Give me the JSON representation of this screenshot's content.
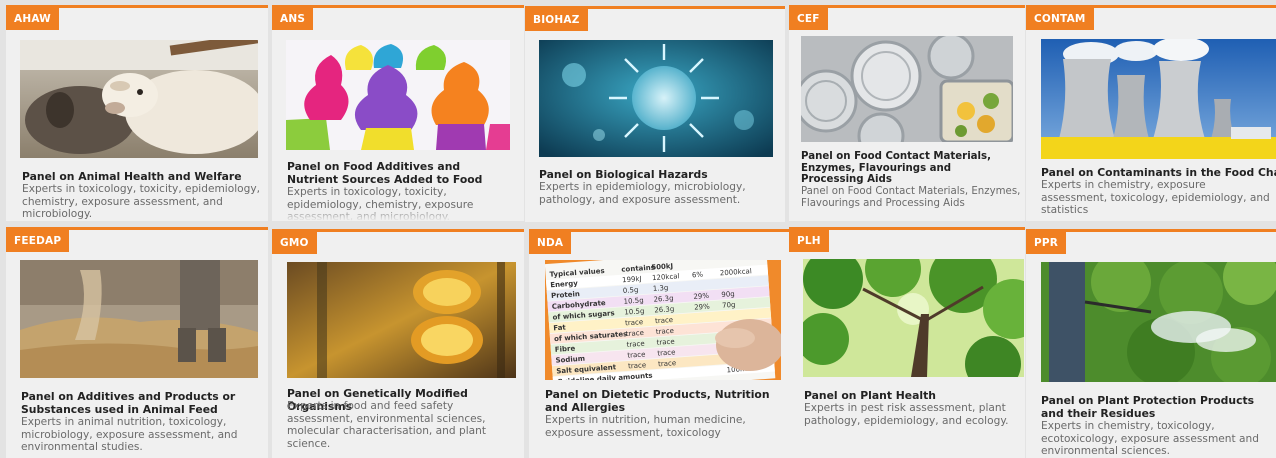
{
  "panels": [
    {
      "tag": "AHAW",
      "title": "Panel on Animal Health and Welfare",
      "description": "Experts in toxicology, toxicity, epidemiology, chemistry, exposure assessment, and microbiology."
    },
    {
      "tag": "ANS",
      "title": "Panel on Food Additives and Nutrient Sources Added to Food",
      "description": "Experts in toxicology, toxicity, epidemiology, chemistry, exposure assessment, and microbiology."
    },
    {
      "tag": "BIOHAZ",
      "title": "Panel on Biological Hazards",
      "description": "Experts in epidemiology, microbiology, pathology, and exposure assessment."
    },
    {
      "tag": "CEF",
      "title": "Panel on Food Contact Materials, Enzymes, Flavourings and Processing Aids",
      "description": "Panel on Food Contact Materials, Enzymes, Flavourings and Processing Aids"
    },
    {
      "tag": "CONTAM",
      "title": "Panel on Contaminants in the Food Chain",
      "description": "Experts in chemistry, exposure assessment, toxicology, epidemiology, and statistics"
    },
    {
      "tag": "FEEDAP",
      "title": "Panel on Additives and Products or Substances used in Animal Feed",
      "description": "Experts in animal nutrition, toxicology, microbiology, exposure assessment, and environmental studies."
    },
    {
      "tag": "GMO",
      "title": "Panel on Genetically Modified Organisms",
      "description": "Experts in food and feed safety assessment, environmental sciences, molecular characterisation, and plant science."
    },
    {
      "tag": "NDA",
      "title": "Panel on Dietetic Products, Nutrition and Allergies",
      "description": "Experts in nutrition, human medicine, exposure assessment, toxicology"
    },
    {
      "tag": "PLH",
      "title": "Panel on Plant Health",
      "description": "Experts in pest risk assessment, plant pathology, epidemiology, and ecology."
    },
    {
      "tag": "PPR",
      "title": "Panel on Plant Protection Products and their Residues",
      "description": "Experts in chemistry, toxicology, ecotoxicology, exposure assessment and environmental sciences."
    }
  ],
  "nutrition_label": {
    "header": [
      "Typical values",
      "contains",
      "500kJ"
    ],
    "rows": [
      [
        "Energy",
        "199kJ",
        "120kcal",
        "6%",
        "2000kcal"
      ],
      [
        "Protein",
        "0.5g",
        "1.3g"
      ],
      [
        "Carbohydrate",
        "10.5g",
        "26.3g",
        "29%",
        "90g"
      ],
      [
        "of which sugars",
        "10.5g",
        "26.3g",
        "29%",
        "70g"
      ],
      [
        "Fat",
        "trace",
        "trace"
      ],
      [
        "of which saturates",
        "trace",
        "trace"
      ],
      [
        "Fibre",
        "trace",
        "trace"
      ],
      [
        "Sodium",
        "trace",
        "trace"
      ],
      [
        "Salt equivalent",
        "trace",
        "trace"
      ],
      [
        "Guideline daily amounts",
        "",
        "",
        "",
        "100ml"
      ]
    ]
  },
  "colors": {
    "accent": "#f07f21",
    "card_bg": "#f0f0f0",
    "page_bg": "#e3e3e3",
    "title_text": "#222222",
    "desc_text": "#6a6a6a"
  }
}
